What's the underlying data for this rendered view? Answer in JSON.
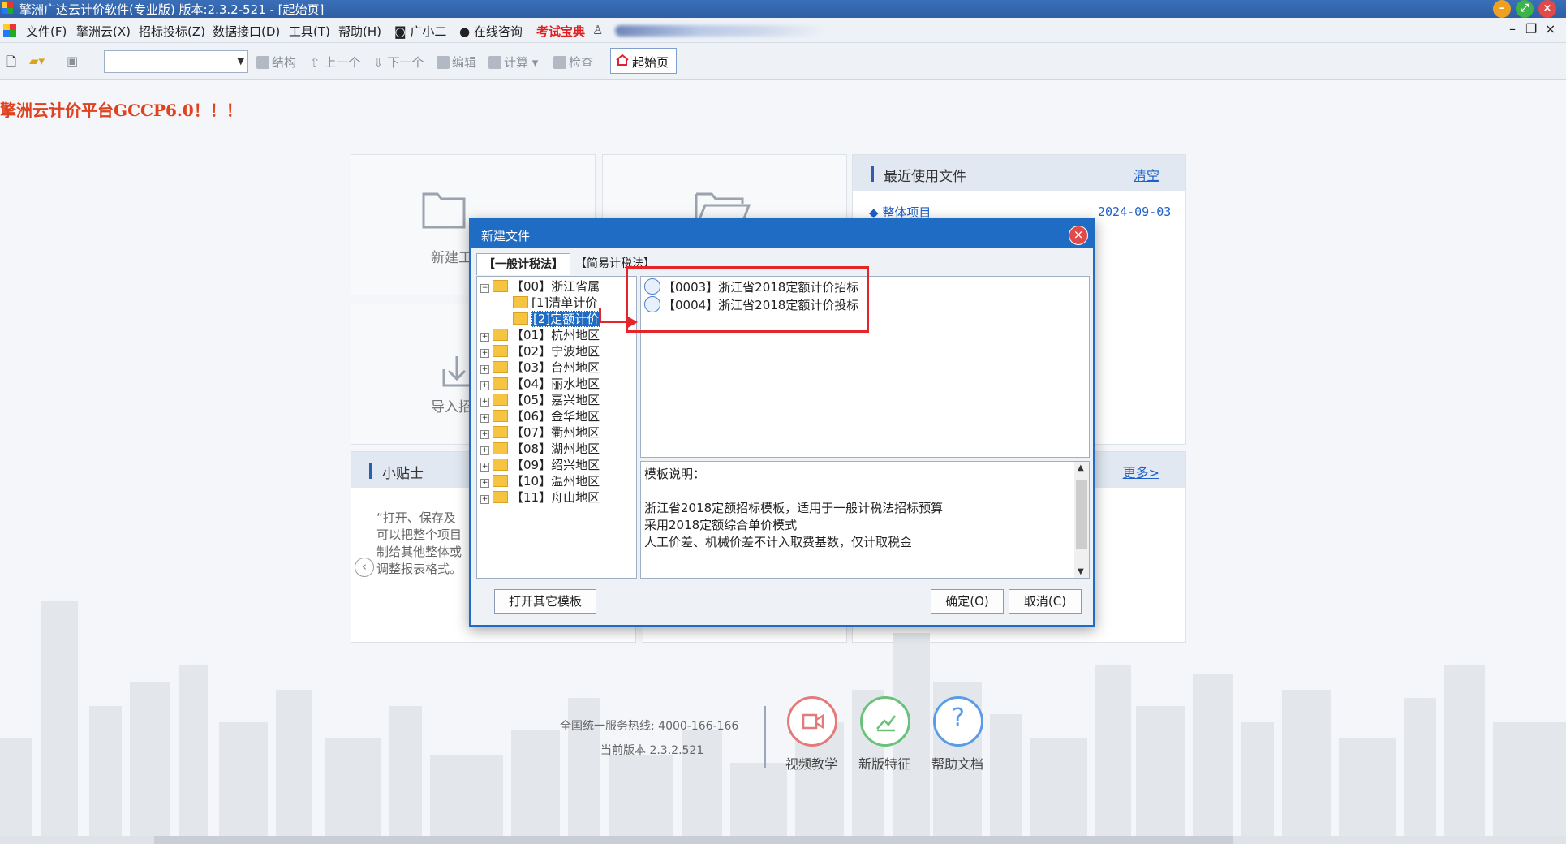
{
  "window": {
    "title": "擎洲广达云计价软件(专业版) 版本:2.3.2-521 - [起始页]"
  },
  "menu": {
    "items": [
      "文件(F)",
      "擎洲云(X)",
      "招标投标(Z)",
      "数据接口(D)",
      "工具(T)",
      "帮助(H)"
    ],
    "guangxiaoer": "广小二",
    "online_consult": "在线咨询",
    "exam": "考试宝典"
  },
  "toolbar": {
    "structure": "结构",
    "prev": "上一个",
    "next": "下一个",
    "edit": "编辑",
    "calc": "计算",
    "check": "检查",
    "home": "起始页"
  },
  "banner": "擎洲云计价平台GCCP6.0！！！",
  "cards": {
    "new_project": "新建工",
    "import": "导入招"
  },
  "recent": {
    "title": "最近使用文件",
    "clear": "清空",
    "items": [
      {
        "name": "整体项目",
        "date": "2024-09-03"
      }
    ]
  },
  "tips": {
    "title": "小贴士",
    "more": "更多>",
    "lines": [
      "“打开、保存及",
      "可以把整个项目",
      "制给其他整体或",
      "调整报表格式。"
    ]
  },
  "footer": {
    "hotline": "全国统一服务热线: 4000-166-166",
    "version": "当前版本 2.3.2.521",
    "video": "视频教学",
    "features": "新版特征",
    "help": "帮助文档"
  },
  "dialog": {
    "title": "新建文件",
    "tabs": [
      "【一般计税法】",
      "【简易计税法】"
    ],
    "tree": [
      {
        "label": "【00】浙江省属",
        "level": 0,
        "expanded": true
      },
      {
        "label": "[1]清单计价",
        "level": 1
      },
      {
        "label": "[2]定额计价",
        "level": 1,
        "selected": true
      },
      {
        "label": "【01】杭州地区",
        "level": 0
      },
      {
        "label": "【02】宁波地区",
        "level": 0
      },
      {
        "label": "【03】台州地区",
        "level": 0
      },
      {
        "label": "【04】丽水地区",
        "level": 0
      },
      {
        "label": "【05】嘉兴地区",
        "level": 0
      },
      {
        "label": "【06】金华地区",
        "level": 0
      },
      {
        "label": "【07】衢州地区",
        "level": 0
      },
      {
        "label": "【08】湖州地区",
        "level": 0
      },
      {
        "label": "【09】绍兴地区",
        "level": 0
      },
      {
        "label": "【10】温州地区",
        "level": 0
      },
      {
        "label": "【11】舟山地区",
        "level": 0
      }
    ],
    "templates": [
      "【0003】浙江省2018定额计价招标",
      "【0004】浙江省2018定额计价投标"
    ],
    "desc_header": "模板说明：",
    "desc_lines": [
      "浙江省2018定额招标模板，适用于一般计税法招标预算",
      "采用2018定额综合单价模式",
      "人工价差、机械价差不计入取费基数，仅计取税金"
    ],
    "open_other": "打开其它模板",
    "ok": "确定(O)",
    "cancel": "取消(C)"
  }
}
